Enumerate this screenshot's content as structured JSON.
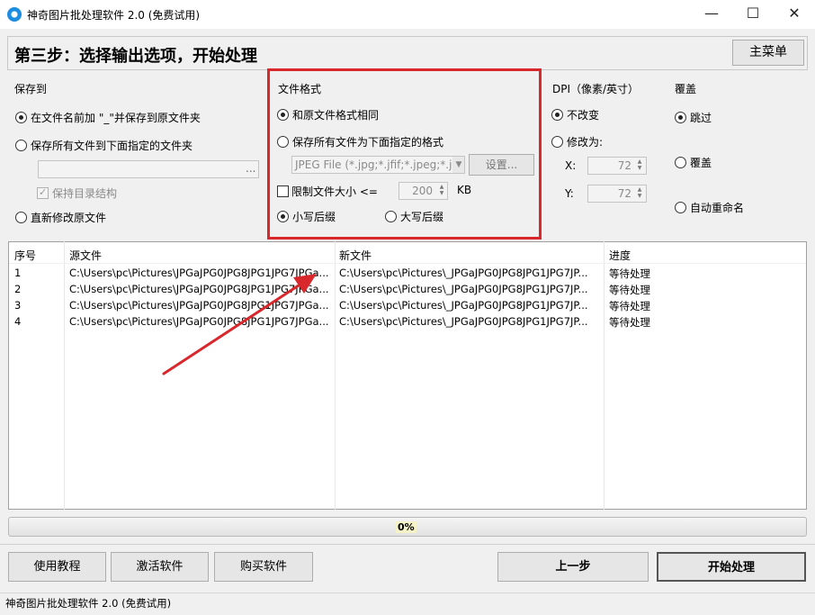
{
  "window": {
    "title": "神奇图片批处理软件 2.0 (免费试用)",
    "min_glyph": "—",
    "max_glyph": "☐",
    "close_glyph": "✕"
  },
  "header": {
    "step_title": "第三步：选择输出选项，开始处理",
    "main_menu": "主菜单"
  },
  "save_to": {
    "title": "保存到",
    "opt_prefix": "在文件名前加 \"_\"并保存到原文件夹",
    "opt_folder": "保存所有文件到下面指定的文件夹",
    "folder_value": "",
    "browse": "...",
    "keep_structure": "保持目录结构",
    "opt_overwrite": "直新修改原文件"
  },
  "file_format": {
    "title": "文件格式",
    "opt_same": "和原文件格式相同",
    "opt_specified": "保存所有文件为下面指定的格式",
    "format_value": "JPEG File (*.jpg;*.jfif;*.jpeg;*.j",
    "settings": "设置...",
    "limit_size": "限制文件大小  <=",
    "size_value": "200",
    "size_unit": "KB",
    "lowercase": "小写后缀",
    "uppercase": "大写后缀"
  },
  "dpi": {
    "title": "DPI（像素/英寸）",
    "opt_keep": "不改变",
    "opt_change": "修改为:",
    "x_label": "X:",
    "x_value": "72",
    "y_label": "Y:",
    "y_value": "72"
  },
  "overwrite": {
    "title": "覆盖",
    "opt_skip": "跳过",
    "opt_overwrite": "覆盖",
    "opt_rename": "自动重命名"
  },
  "table": {
    "headers": [
      "序号",
      "源文件",
      "新文件",
      "进度"
    ],
    "rows": [
      {
        "no": "1",
        "src": "C:\\Users\\pc\\Pictures\\JPGaJPG0JPG8JPG1JPG7JPGa...",
        "dst": "C:\\Users\\pc\\Pictures\\_JPGaJPG0JPG8JPG1JPG7JP...",
        "status": "等待处理"
      },
      {
        "no": "2",
        "src": "C:\\Users\\pc\\Pictures\\JPGaJPG0JPG8JPG1JPG7JPGa...",
        "dst": "C:\\Users\\pc\\Pictures\\_JPGaJPG0JPG8JPG1JPG7JP...",
        "status": "等待处理"
      },
      {
        "no": "3",
        "src": "C:\\Users\\pc\\Pictures\\JPGaJPG0JPG8JPG1JPG7JPGa...",
        "dst": "C:\\Users\\pc\\Pictures\\_JPGaJPG0JPG8JPG1JPG7JP...",
        "status": "等待处理"
      },
      {
        "no": "4",
        "src": "C:\\Users\\pc\\Pictures\\JPGaJPG0JPG8JPG1JPG7JPGa...",
        "dst": "C:\\Users\\pc\\Pictures\\_JPGaJPG0JPG8JPG1JPG7JP...",
        "status": "等待处理"
      }
    ]
  },
  "progress": {
    "value": 0,
    "label": "0%"
  },
  "buttons": {
    "tutorial": "使用教程",
    "activate": "激活软件",
    "buy": "购买软件",
    "prev": "上一步",
    "start": "开始处理"
  },
  "status_bar": {
    "text": "神奇图片批处理软件 2.0 (免费试用)"
  },
  "colors": {
    "highlight": "#d9282c",
    "arrow": "#d9282c",
    "progress_label_bg": "#f5f2c8"
  }
}
